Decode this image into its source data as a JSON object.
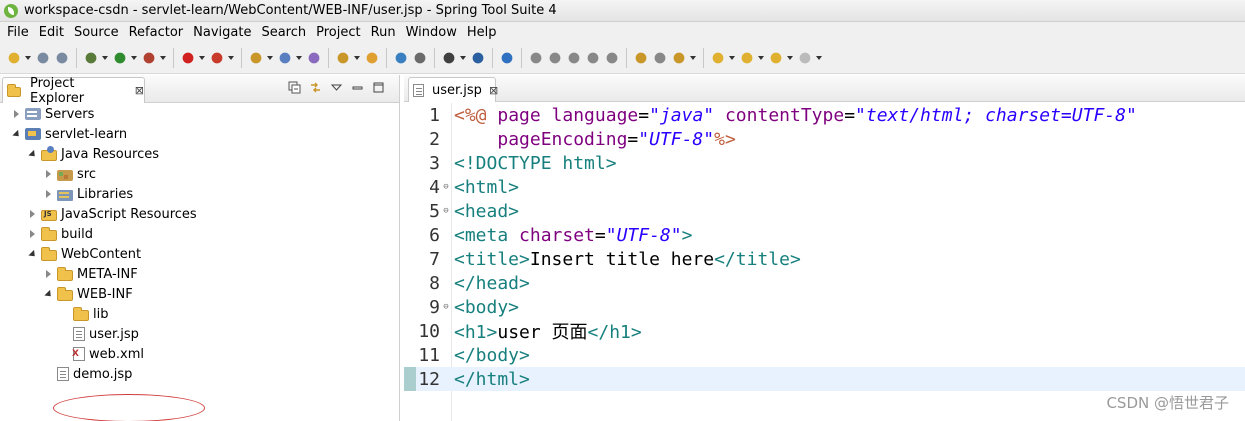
{
  "window": {
    "title": "workspace-csdn - servlet-learn/WebContent/WEB-INF/user.jsp - Spring Tool Suite 4"
  },
  "menu": [
    "File",
    "Edit",
    "Source",
    "Refactor",
    "Navigate",
    "Search",
    "Project",
    "Run",
    "Window",
    "Help"
  ],
  "toolbar": {
    "icons": [
      "new-icon",
      "save-icon",
      "save-all-icon",
      "debug-icon",
      "run-icon",
      "run-external-icon",
      "stop-icon",
      "deploy-icon",
      "new-project-icon",
      "new-class-icon",
      "open-type-icon",
      "open-task-icon",
      "open-resource-icon",
      "web-browser-icon",
      "search-icon",
      "perspective-icon",
      "console-icon",
      "skip-breakpoints-icon",
      "resume-icon",
      "suspend-icon",
      "terminate-icon",
      "disconnect-icon",
      "step-into-icon",
      "step-over-icon",
      "step-return-icon",
      "next-annotation-icon",
      "prev-annotation-icon",
      "last-edit-icon",
      "back-icon",
      "forward-icon"
    ]
  },
  "explorer": {
    "tab_label": "Project Explorer",
    "close_glyph": "⊠",
    "tree": [
      {
        "label": "Servers",
        "depth": 0,
        "state": "collapsed",
        "icon": "server-icon"
      },
      {
        "label": "servlet-learn",
        "depth": 0,
        "state": "expanded",
        "icon": "project-icon"
      },
      {
        "label": "Java Resources",
        "depth": 1,
        "state": "expanded",
        "icon": "java-resources-icon"
      },
      {
        "label": "src",
        "depth": 2,
        "state": "collapsed",
        "icon": "package-icon"
      },
      {
        "label": "Libraries",
        "depth": 2,
        "state": "collapsed",
        "icon": "library-icon"
      },
      {
        "label": "JavaScript Resources",
        "depth": 1,
        "state": "collapsed",
        "icon": "javascript-resources-icon"
      },
      {
        "label": "build",
        "depth": 1,
        "state": "collapsed",
        "icon": "folder-icon"
      },
      {
        "label": "WebContent",
        "depth": 1,
        "state": "expanded",
        "icon": "folder-icon"
      },
      {
        "label": "META-INF",
        "depth": 2,
        "state": "collapsed",
        "icon": "folder-icon"
      },
      {
        "label": "WEB-INF",
        "depth": 2,
        "state": "expanded",
        "icon": "folder-icon"
      },
      {
        "label": "lib",
        "depth": 3,
        "state": "none",
        "icon": "folder-icon"
      },
      {
        "label": "user.jsp",
        "depth": 3,
        "state": "none",
        "icon": "jsp-file-icon"
      },
      {
        "label": "web.xml",
        "depth": 3,
        "state": "none",
        "icon": "xml-file-icon"
      },
      {
        "label": "demo.jsp",
        "depth": 2,
        "state": "none",
        "icon": "jsp-file-icon"
      }
    ]
  },
  "editor": {
    "tab_label": "user.jsp",
    "close_glyph": "⊠",
    "current_line": 12,
    "lines": [
      {
        "n": "1",
        "fold": "",
        "tokens": [
          [
            "dir",
            "<%@ "
          ],
          [
            "attr",
            "page "
          ],
          [
            "attr",
            "language"
          ],
          [
            "txt",
            "="
          ],
          [
            "str",
            "\"java\""
          ],
          [
            "txt",
            " "
          ],
          [
            "attr",
            "contentType"
          ],
          [
            "txt",
            "="
          ],
          [
            "str",
            "\"text/html; charset=UTF-8\""
          ]
        ]
      },
      {
        "n": "2",
        "fold": "",
        "tokens": [
          [
            "txt",
            "    "
          ],
          [
            "attr",
            "pageEncoding"
          ],
          [
            "txt",
            "="
          ],
          [
            "str",
            "\"UTF-8\""
          ],
          [
            "dir",
            "%>"
          ]
        ]
      },
      {
        "n": "3",
        "fold": "",
        "tokens": [
          [
            "tag",
            "<!DOCTYPE html>"
          ]
        ]
      },
      {
        "n": "4",
        "fold": "⊖",
        "tokens": [
          [
            "tag",
            "<html>"
          ]
        ]
      },
      {
        "n": "5",
        "fold": "⊖",
        "tokens": [
          [
            "tag",
            "<head>"
          ]
        ]
      },
      {
        "n": "6",
        "fold": "",
        "tokens": [
          [
            "tag",
            "<meta "
          ],
          [
            "attr",
            "charset"
          ],
          [
            "txt",
            "="
          ],
          [
            "str",
            "\"UTF-8\""
          ],
          [
            "tag",
            ">"
          ]
        ]
      },
      {
        "n": "7",
        "fold": "",
        "tokens": [
          [
            "tag",
            "<title>"
          ],
          [
            "txt",
            "Insert title here"
          ],
          [
            "tag",
            "</title>"
          ]
        ]
      },
      {
        "n": "8",
        "fold": "",
        "tokens": [
          [
            "tag",
            "</head>"
          ]
        ]
      },
      {
        "n": "9",
        "fold": "⊖",
        "tokens": [
          [
            "tag",
            "<body>"
          ]
        ]
      },
      {
        "n": "10",
        "fold": "",
        "tokens": [
          [
            "tag",
            "<h1>"
          ],
          [
            "txt",
            "user 页面"
          ],
          [
            "tag",
            "</h1>"
          ]
        ]
      },
      {
        "n": "11",
        "fold": "",
        "tokens": [
          [
            "tag",
            "</body>"
          ]
        ]
      },
      {
        "n": "12",
        "fold": "",
        "tokens": [
          [
            "tag",
            "</html>"
          ]
        ]
      }
    ]
  },
  "watermark": "CSDN @悟世君子",
  "colors": {
    "tag": "#17807e",
    "attribute": "#7f007f",
    "string": "#2a00ff",
    "directive": "#bf5f3f",
    "current_line_bg": "#e8f2fe",
    "annotation_ellipse": "#d23c3c"
  }
}
